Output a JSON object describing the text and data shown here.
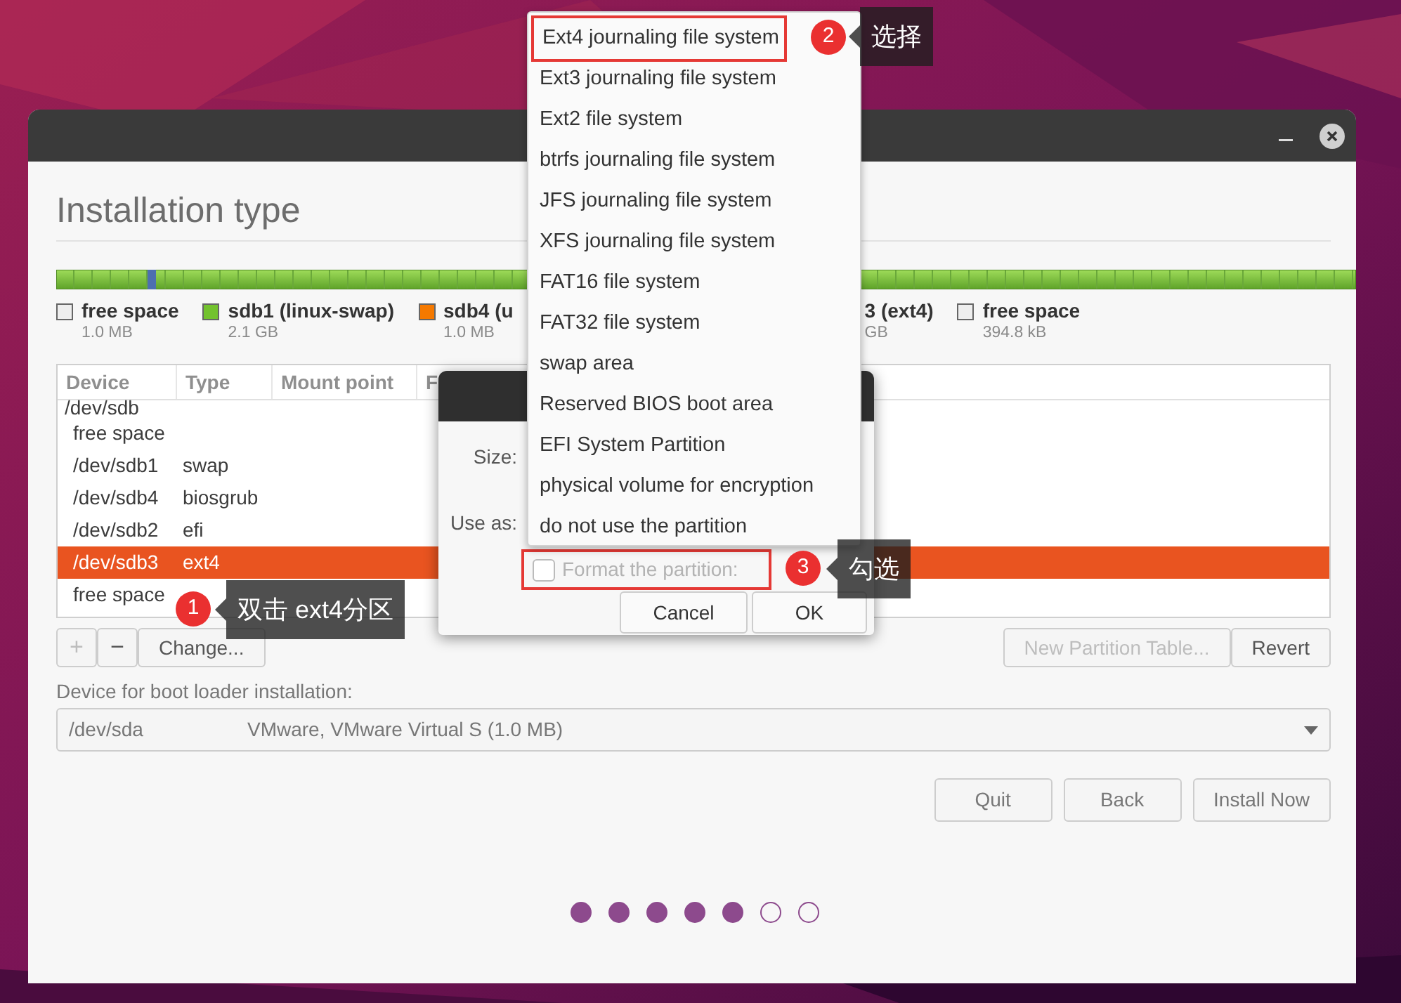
{
  "page_title": "Installation type",
  "legend": [
    {
      "label": "free space",
      "size": "1.0 MB",
      "color": "#eeeeee"
    },
    {
      "label": "sdb1 (linux-swap)",
      "size": "2.1 GB",
      "color": "#73c22e"
    },
    {
      "label": "sdb4 (u",
      "size": "1.0 MB",
      "color": "#f57900"
    },
    {
      "label": "3 (ext4)",
      "size": "GB"
    },
    {
      "label": "free space",
      "size": "394.8 kB",
      "color": "#eeeeee"
    }
  ],
  "table": {
    "columns": [
      "Device",
      "Type",
      "Mount point",
      "F"
    ],
    "rows": [
      {
        "cells": [
          "/dev/sdb"
        ],
        "selected": false,
        "children": [
          {
            "cells": [
              "free space"
            ],
            "selected": false
          },
          {
            "cells": [
              "/dev/sdb1",
              "swap"
            ],
            "selected": false
          },
          {
            "cells": [
              "/dev/sdb4",
              "biosgrub"
            ],
            "selected": false
          },
          {
            "cells": [
              "/dev/sdb2",
              "efi"
            ],
            "selected": false
          },
          {
            "cells": [
              "/dev/sdb3",
              "ext4"
            ],
            "selected": true
          },
          {
            "cells": [
              "free space"
            ],
            "selected": false
          }
        ]
      }
    ]
  },
  "partition_buttons": [
    {
      "label": "+",
      "disabled": true
    },
    {
      "label": "−",
      "disabled": false
    },
    {
      "label": "Change...",
      "disabled": false
    }
  ],
  "table_buttons": [
    {
      "label": "New Partition Table...",
      "disabled": true
    },
    {
      "label": "Revert",
      "disabled": false
    }
  ],
  "boot_loader": {
    "label": "Device for boot loader installation:",
    "device": "/dev/sda",
    "description": "VMware, VMware Virtual S (1.0 MB)"
  },
  "nav_buttons": [
    "Quit",
    "Back",
    "Install Now"
  ],
  "progress_dots": [
    {
      "filled": true
    },
    {
      "filled": true
    },
    {
      "filled": true
    },
    {
      "filled": true
    },
    {
      "filled": true
    },
    {
      "filled": false
    },
    {
      "filled": false
    }
  ],
  "dialog": {
    "size_label": "Size:",
    "use_as_label": "Use as:",
    "format_checkbox": {
      "label": "Format the partition:",
      "checked": false,
      "disabled": true,
      "annotated": true
    },
    "buttons": [
      "Cancel",
      "OK"
    ]
  },
  "dropdown": {
    "items": [
      {
        "label": "Ext4 journaling file system",
        "annotated": true
      },
      {
        "label": "Ext3 journaling file system",
        "annotated": false
      },
      {
        "label": "Ext2 file system",
        "annotated": false
      },
      {
        "label": "btrfs journaling file system",
        "annotated": false
      },
      {
        "label": "JFS journaling file system",
        "annotated": false
      },
      {
        "label": "XFS journaling file system",
        "annotated": false
      },
      {
        "label": "FAT16 file system",
        "annotated": false
      },
      {
        "label": "FAT32 file system",
        "annotated": false
      },
      {
        "label": "swap area",
        "annotated": false
      },
      {
        "label": "Reserved BIOS boot area",
        "annotated": false
      },
      {
        "label": "EFI System Partition",
        "annotated": false
      },
      {
        "label": "physical volume for encryption",
        "annotated": false
      },
      {
        "label": "do not use the partition",
        "annotated": false
      }
    ]
  },
  "callouts": [
    {
      "number": "1",
      "text": "双击 ext4分区"
    },
    {
      "number": "2",
      "text": "选择"
    },
    {
      "number": "3",
      "text": "勾选"
    }
  ]
}
